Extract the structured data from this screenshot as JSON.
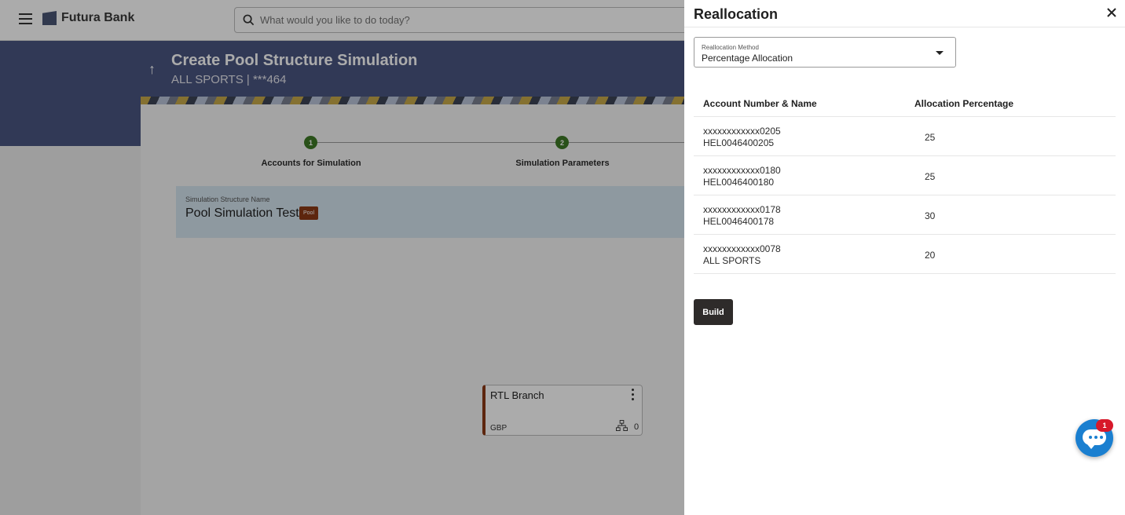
{
  "app": {
    "brand": "Futura Bank"
  },
  "search": {
    "placeholder": "What would you like to do today?"
  },
  "page": {
    "title": "Create Pool Structure Simulation",
    "subtitle": "ALL SPORTS | ***464"
  },
  "steps": [
    {
      "number": "1",
      "label": "Accounts for Simulation"
    },
    {
      "number": "2",
      "label": "Simulation Parameters"
    }
  ],
  "simulation": {
    "structure_label": "Simulation Structure Name",
    "structure_name": "Pool Simulation Test1",
    "badge": "Pool"
  },
  "branch_card": {
    "name": "RTL Branch",
    "currency": "GBP",
    "child_count": "0"
  },
  "drawer": {
    "title": "Reallocation",
    "method": {
      "label": "Reallocation Method",
      "value": "Percentage Allocation"
    },
    "table": {
      "headers": [
        "Account Number & Name",
        "Allocation Percentage"
      ],
      "rows": [
        {
          "account_number": "xxxxxxxxxxxx0205",
          "account_name": "HEL0046400205",
          "percentage": "25"
        },
        {
          "account_number": "xxxxxxxxxxxx0180",
          "account_name": "HEL0046400180",
          "percentage": "25"
        },
        {
          "account_number": "xxxxxxxxxxxx0178",
          "account_name": "HEL0046400178",
          "percentage": "30"
        },
        {
          "account_number": "xxxxxxxxxxxx0078",
          "account_name": "ALL SPORTS",
          "percentage": "20"
        }
      ]
    },
    "build_label": "Build"
  },
  "chat": {
    "badge_count": "1"
  },
  "colors": {
    "hero": "#4a5680",
    "step_active": "#3e7a26",
    "pool_badge": "#8b3a16",
    "primary_button": "#2e2b2a",
    "chat": "#1a7fd0",
    "notification": "#d7182a"
  }
}
